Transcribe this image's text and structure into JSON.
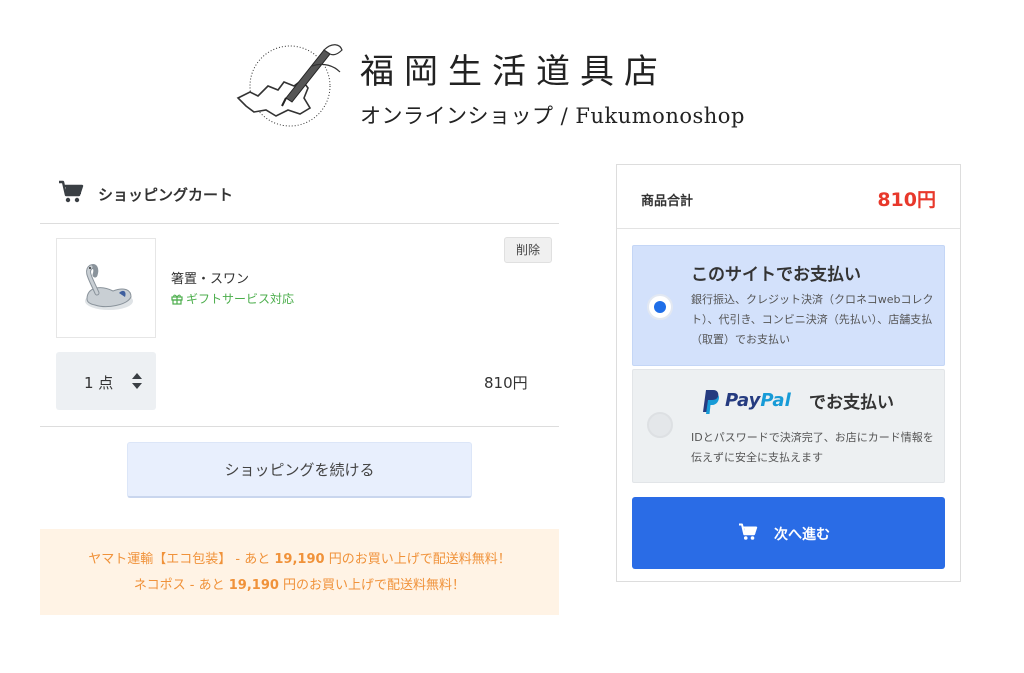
{
  "brand": {
    "title": "福岡生活道具店",
    "subtitle": "オンラインショップ / Fukumonoshop",
    "logo_icon": "fukuoka-map-pen-logo"
  },
  "cart": {
    "title": "ショッピングカート",
    "icon": "cart-icon",
    "items": [
      {
        "name": "箸置・スワン",
        "gift_label": "ギフトサービス対応",
        "delete_label": "削除",
        "quantity_label": "1 点",
        "price": "810円",
        "thumb_icon": "swan-chopstick-rest-image"
      }
    ],
    "continue_label": "ショッピングを続ける"
  },
  "notice": {
    "line1_prefix": "ヤマト運輸【エコ包装】 - あと ",
    "line1_amount": "19,190",
    "line1_suffix": " 円のお買い上げで配送料無料！",
    "line2_prefix": "ネコポス - あと ",
    "line2_amount": "19,190",
    "line2_suffix": " 円のお買い上げで配送料無料！",
    "color": "#f0923a",
    "background": "#fff3e5"
  },
  "summary": {
    "subtotal_label": "商品合計",
    "subtotal_value": "810円",
    "subtotal_color": "#e8382b"
  },
  "payment": {
    "selected": "site",
    "site": {
      "title": "このサイトでお支払い",
      "description": "銀行振込、クレジット決済（クロネコwebコレクト）、代引き、コンビニ決済（先払い）、店舗支払（取置）でお支払い"
    },
    "paypal": {
      "logo_part1": "Pay",
      "logo_part2": "Pal",
      "title": "でお支払い",
      "description": "IDとパスワードで決済完了、お店にカード情報を伝えずに安全に支払えます"
    },
    "next_label": "次へ進む",
    "accent": "#2a6ce6"
  }
}
